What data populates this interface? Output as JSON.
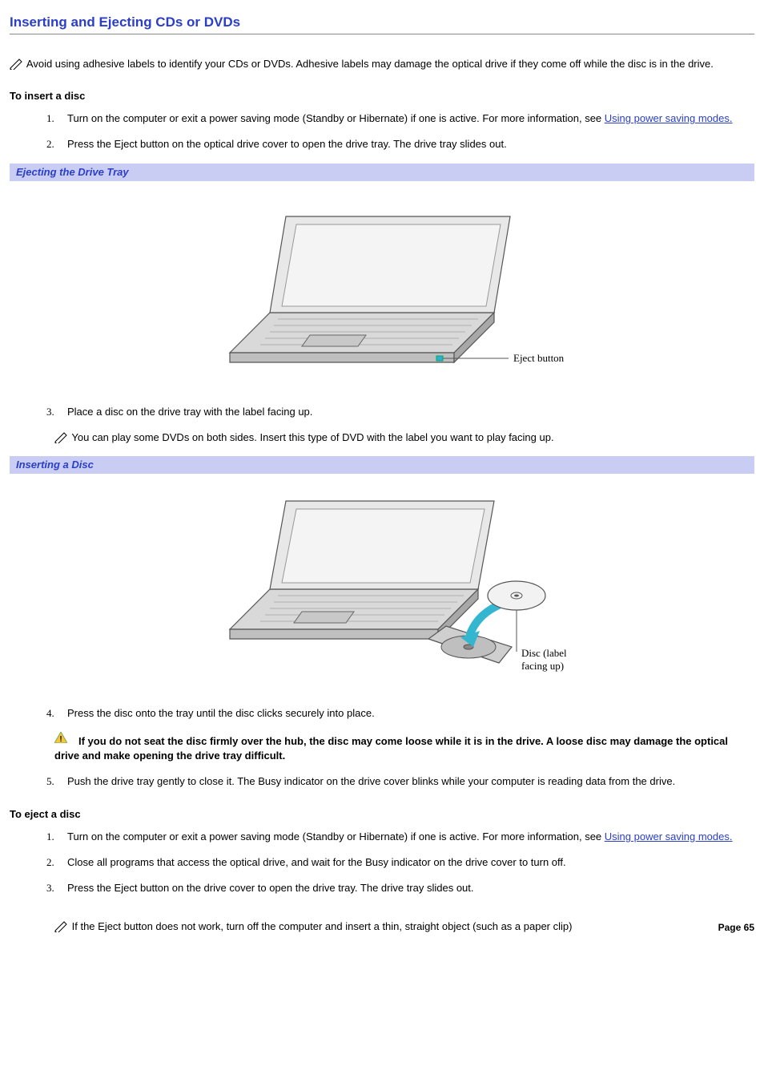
{
  "title": "Inserting and Ejecting CDs or DVDs",
  "top_note": "Avoid using adhesive labels to identify your CDs or DVDs. Adhesive labels may damage the optical drive if they come off while the disc is in the drive.",
  "insert": {
    "heading": "To insert a disc",
    "steps": {
      "s1_a": "Turn on the computer or exit a power saving mode (Standby or Hibernate) if one is active. For more information, see ",
      "s1_link": "Using power saving modes.",
      "s2": "Press the Eject button on the optical drive cover to open the drive tray. The drive tray slides out.",
      "s3": "Place a disc on the drive tray with the label facing up.",
      "s3_note": "You can play some DVDs on both sides. Insert this type of DVD with the label you want to play facing up.",
      "s4": "Press the disc onto the tray until the disc clicks securely into place.",
      "s4_warn": "If you do not seat the disc firmly over the hub, the disc may come loose while it is in the drive. A loose disc may damage the optical drive and make opening the drive tray difficult.",
      "s5": "Push the drive tray gently to close it. The Busy indicator on the drive cover blinks while your computer is reading data from the drive."
    }
  },
  "figure1_caption": "Ejecting the Drive Tray",
  "figure1_label": "Eject button",
  "figure2_caption": "Inserting a Disc",
  "figure2_label1": "Disc (label",
  "figure2_label2": "facing up)",
  "eject": {
    "heading": "To eject a disc",
    "steps": {
      "s1_a": "Turn on the computer or exit a power saving mode (Standby or Hibernate) if one is active. For more information, see ",
      "s1_link": "Using power saving modes.",
      "s2": "Close all programs that access the optical drive, and wait for the Busy indicator on the drive cover to turn off.",
      "s3": "Press the Eject button on the drive cover to open the drive tray. The drive tray slides out.",
      "s_note": "If the Eject button does not work, turn off the computer and insert a thin, straight object (such as a paper clip)"
    }
  },
  "page_number": "Page 65"
}
